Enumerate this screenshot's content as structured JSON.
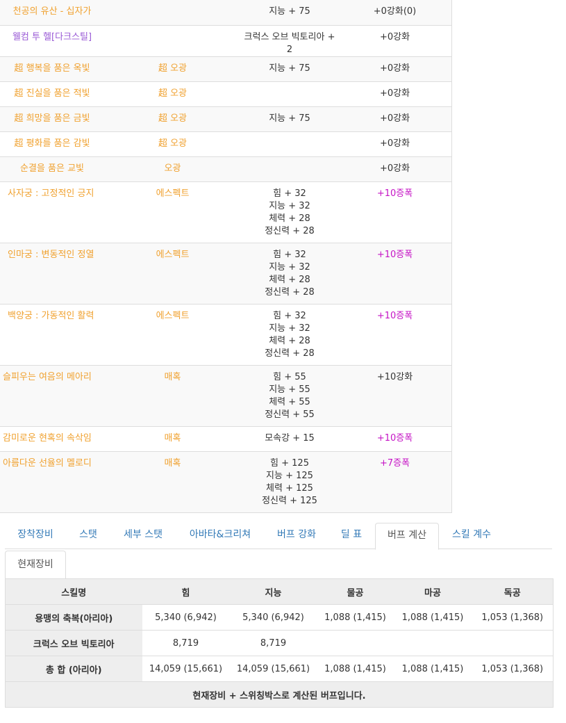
{
  "equipment_rows": [
    {
      "name": "천공의 유산 - 십자가",
      "name_color": "orange",
      "set": "",
      "stats": "지능 + 75",
      "star": "+0강화(0)",
      "star_color": "dark",
      "align": "center"
    },
    {
      "name": "웰컴 투 헬[다크스틸]",
      "name_color": "purple",
      "set": "",
      "stats": "크럭스 오브 빅토리아 + 2",
      "star": "+0강화",
      "star_color": "dark",
      "align": "center"
    },
    {
      "name": "超 행복을 품은 옥빛",
      "name_color": "orange",
      "set": "超 오광",
      "stats": "지능 + 75",
      "star": "+0강화",
      "star_color": "dark",
      "align": "center"
    },
    {
      "name": "超 진실을 품은 적빛",
      "name_color": "orange",
      "set": "超 오광",
      "stats": "",
      "star": "+0강화",
      "star_color": "dark",
      "align": "center"
    },
    {
      "name": "超 희망을 품은 금빛",
      "name_color": "orange",
      "set": "超 오광",
      "stats": "지능 + 75",
      "star": "+0강화",
      "star_color": "dark",
      "align": "center"
    },
    {
      "name": "超 평화를 품은 감빛",
      "name_color": "orange",
      "set": "超 오광",
      "stats": "",
      "star": "+0강화",
      "star_color": "dark",
      "align": "center"
    },
    {
      "name": "순결을 품은 교빛",
      "name_color": "orange",
      "set": "오광",
      "stats": "",
      "star": "+0강화",
      "star_color": "dark",
      "align": "center"
    },
    {
      "name": "사자궁 : 고정적인 긍지",
      "name_color": "orange",
      "set": "에스펙트",
      "stats": "힘 + 32\n지능 + 32\n체력 + 28\n정신력 + 28",
      "star": "+10증폭",
      "star_color": "magenta",
      "align": "indent"
    },
    {
      "name": "인마궁 : 변동적인 정열",
      "name_color": "orange",
      "set": "에스펙트",
      "stats": "힘 + 32\n지능 + 32\n체력 + 28\n정신력 + 28",
      "star": "+10증폭",
      "star_color": "magenta",
      "align": "indent"
    },
    {
      "name": "백양궁 : 가동적인 활력",
      "name_color": "orange",
      "set": "에스펙트",
      "stats": "힘 + 32\n지능 + 32\n체력 + 28\n정신력 + 28",
      "star": "+10증폭",
      "star_color": "magenta",
      "align": "indent"
    },
    {
      "name": "슬피우는 여음의 메아리",
      "name_color": "orange",
      "set": "매혹",
      "stats": "힘 + 55\n지능 + 55\n체력 + 55\n정신력 + 55",
      "star": "+10강화",
      "star_color": "dark",
      "align": "left"
    },
    {
      "name": "감미로운 현혹의 속삭임",
      "name_color": "orange",
      "set": "매혹",
      "stats": "모속강 + 15",
      "star": "+10증폭",
      "star_color": "magenta",
      "align": "left"
    },
    {
      "name": "아름다운 선율의 멜로디",
      "name_color": "orange",
      "set": "매혹",
      "stats": "힘 + 125\n지능 + 125\n체력 + 125\n정신력 + 125",
      "star": "+7증폭",
      "star_color": "magenta",
      "align": "left"
    }
  ],
  "tabs": [
    "장착장비",
    "스탯",
    "세부 스탯",
    "아바타&크리쳐",
    "버프 강화",
    "딜 표",
    "버프 계산",
    "스킬 계수"
  ],
  "active_tab": "버프 계산",
  "subtab": "현재장비",
  "buff_table": {
    "headers": [
      "스킬명",
      "힘",
      "지능",
      "물공",
      "마공",
      "독공"
    ],
    "rows": [
      [
        "용맹의 축복(아리아)",
        "5,340 (6,942)",
        "5,340 (6,942)",
        "1,088 (1,415)",
        "1,088 (1,415)",
        "1,053 (1,368)"
      ],
      [
        "크럭스 오브 빅토리아",
        "8,719",
        "8,719",
        "",
        "",
        ""
      ],
      [
        "총 합 (아리아)",
        "14,059 (15,661)",
        "14,059 (15,661)",
        "1,088 (1,415)",
        "1,088 (1,415)",
        "1,053 (1,368)"
      ]
    ],
    "footer": "현재장비 + 스위칭박스로 계산된 버프입니다."
  },
  "colors": {
    "orange": "#f0a12f",
    "purple": "#9a5bd6",
    "magenta": "#c513c5",
    "link": "#337ab7"
  }
}
